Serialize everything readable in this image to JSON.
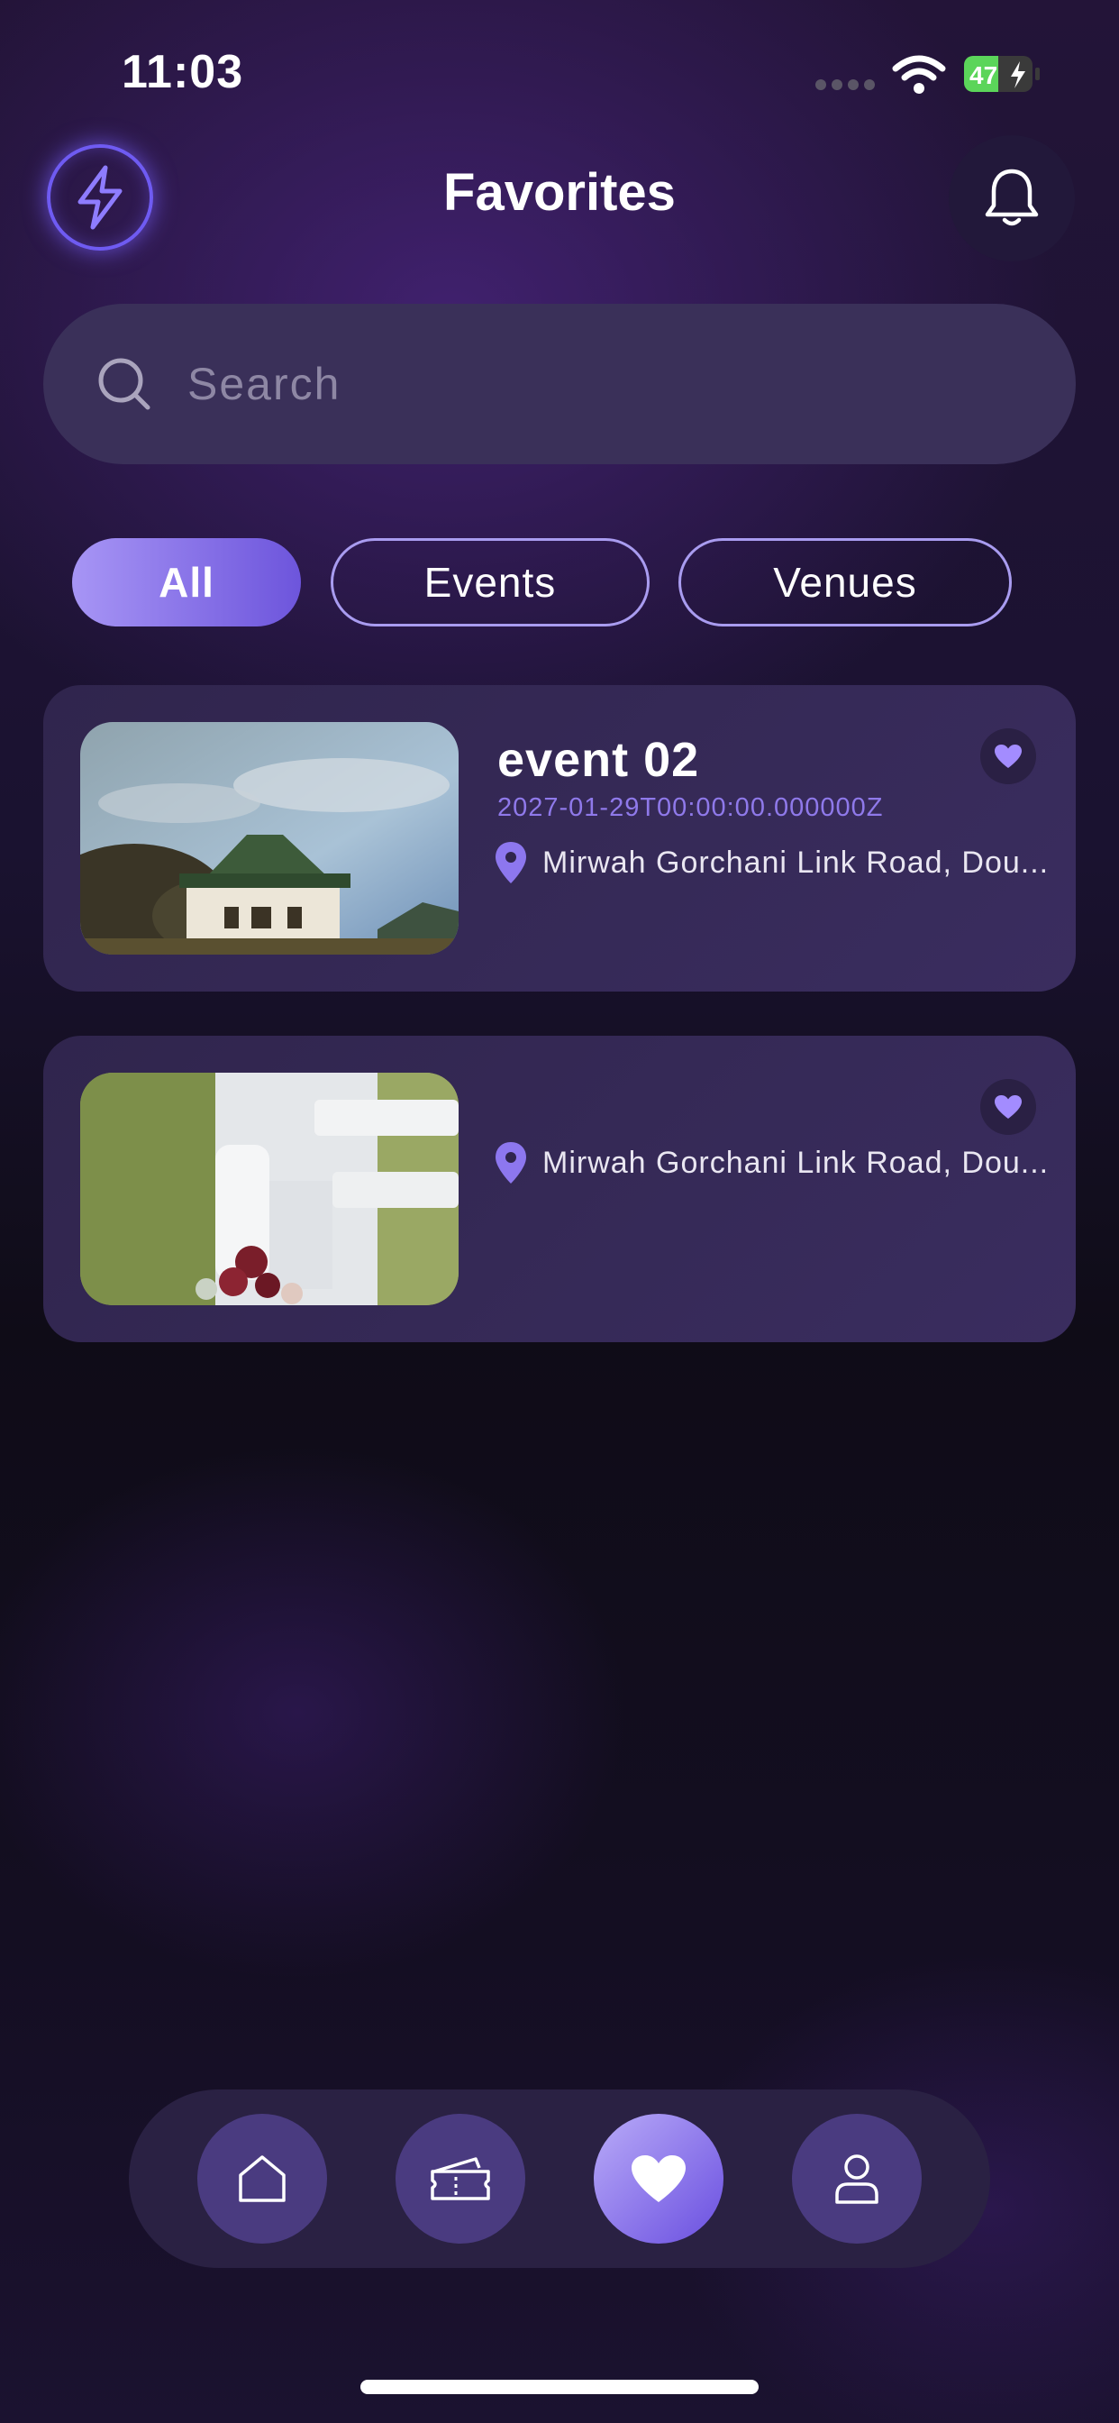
{
  "status_bar": {
    "time": "11:03",
    "battery": "47"
  },
  "header": {
    "title": "Favorites",
    "logo_icon": "lightning-icon",
    "notification_icon": "bell-icon"
  },
  "search": {
    "placeholder": "Search",
    "value": ""
  },
  "filters": {
    "all": "All",
    "events": "Events",
    "venues": "Venues",
    "selected": "All"
  },
  "favorites": [
    {
      "title": "event 02",
      "date": "2027-01-29T00:00:00.000000Z",
      "location": "Mirwah Gorchani Link Road, Dou...",
      "favorited": true
    },
    {
      "title": "",
      "date": "",
      "location": "Mirwah Gorchani Link Road, Dou...",
      "favorited": true
    }
  ],
  "tab_bar": {
    "tabs": [
      "home-icon",
      "ticket-icon",
      "heart-icon",
      "user-icon"
    ],
    "active": "heart-icon"
  },
  "colors": {
    "accent": "#7b62e8",
    "chip_active_start": "#a795f5",
    "chip_active_end": "#6d55dc",
    "card_bg": "#33284f",
    "date_text": "#8f79ea"
  }
}
